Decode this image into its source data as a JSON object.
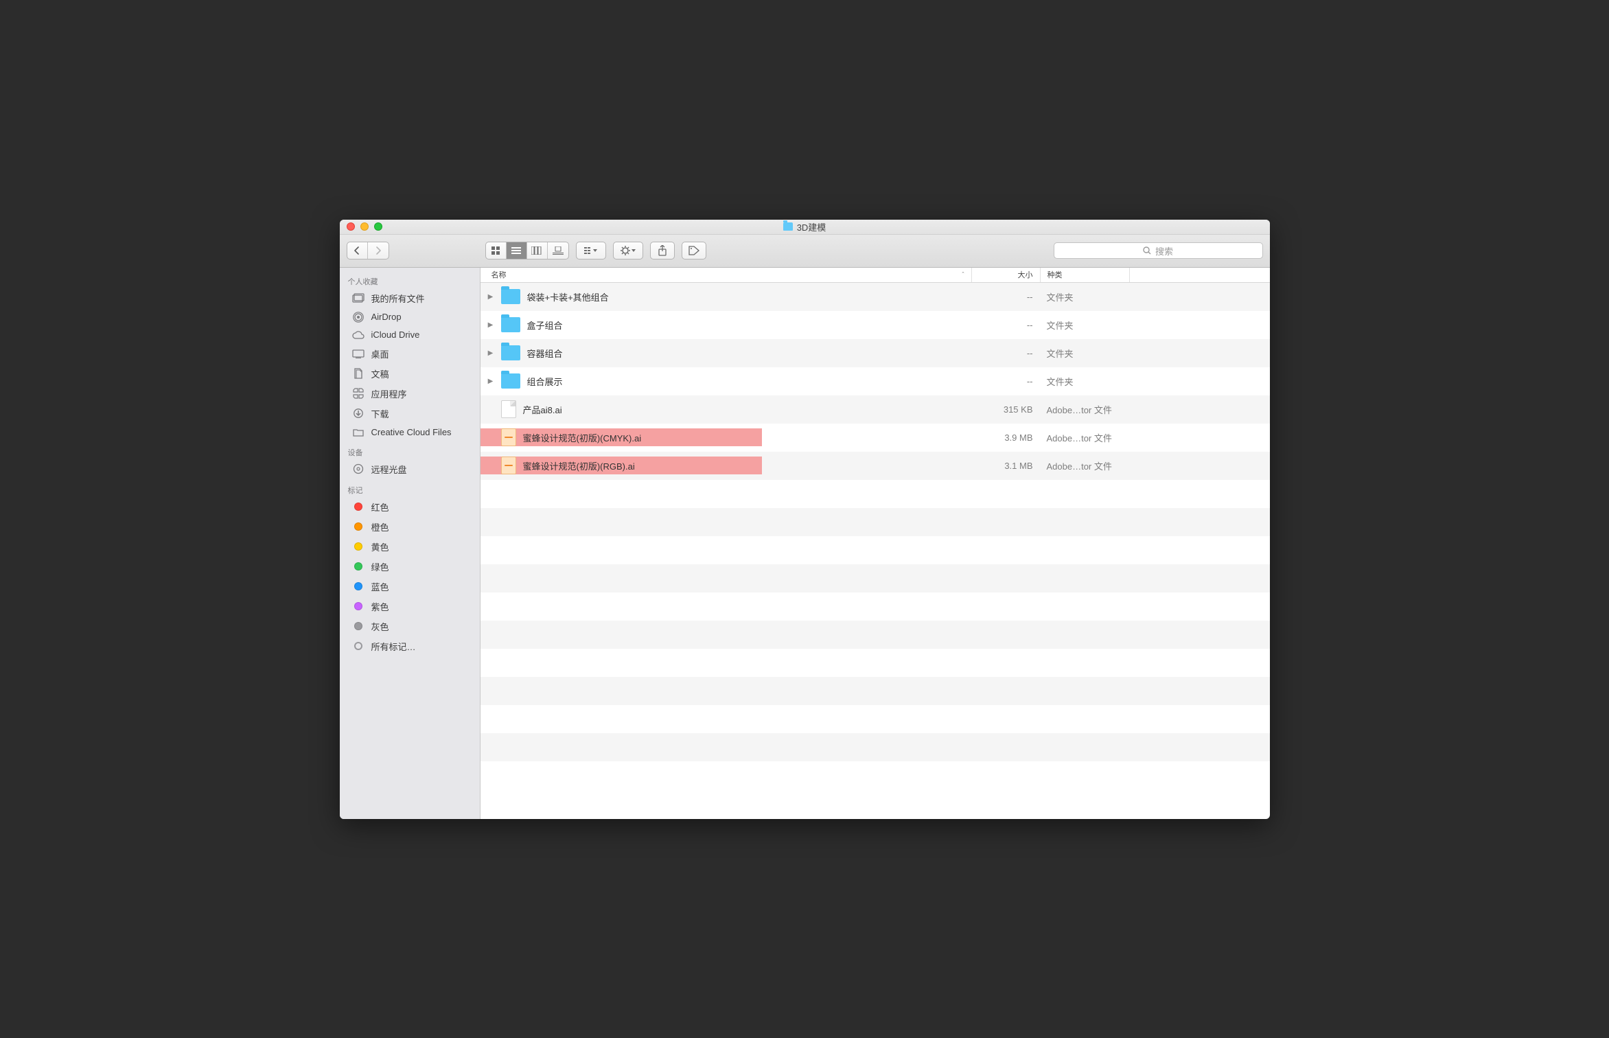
{
  "window": {
    "title": "3D建模"
  },
  "search": {
    "placeholder": "搜索"
  },
  "sidebar": {
    "favorites_header": "个人收藏",
    "favorites": [
      {
        "label": "我的所有文件",
        "icon": "all-files"
      },
      {
        "label": "AirDrop",
        "icon": "airdrop"
      },
      {
        "label": "iCloud Drive",
        "icon": "icloud"
      },
      {
        "label": "桌面",
        "icon": "desktop"
      },
      {
        "label": "文稿",
        "icon": "documents"
      },
      {
        "label": "应用程序",
        "icon": "applications"
      },
      {
        "label": "下载",
        "icon": "downloads"
      },
      {
        "label": "Creative Cloud Files",
        "icon": "folder"
      }
    ],
    "devices_header": "设备",
    "devices": [
      {
        "label": "远程光盘",
        "icon": "disc"
      }
    ],
    "tags_header": "标记",
    "tags": [
      {
        "label": "红色",
        "color": "red"
      },
      {
        "label": "橙色",
        "color": "orange"
      },
      {
        "label": "黄色",
        "color": "yellow"
      },
      {
        "label": "绿色",
        "color": "green"
      },
      {
        "label": "蓝色",
        "color": "blue"
      },
      {
        "label": "紫色",
        "color": "purple"
      },
      {
        "label": "灰色",
        "color": "gray"
      },
      {
        "label": "所有标记…",
        "color": "outline"
      }
    ]
  },
  "columns": {
    "name": "名称",
    "size": "大小",
    "kind": "种类",
    "sort_indicator": "ˆ"
  },
  "rows": [
    {
      "type": "folder",
      "name": "袋装+卡装+其他组合",
      "size": "--",
      "kind": "文件夹",
      "highlight": false
    },
    {
      "type": "folder",
      "name": "盒子组合",
      "size": "--",
      "kind": "文件夹",
      "highlight": false
    },
    {
      "type": "folder",
      "name": "容器组合",
      "size": "--",
      "kind": "文件夹",
      "highlight": false
    },
    {
      "type": "folder",
      "name": "组合展示",
      "size": "--",
      "kind": "文件夹",
      "highlight": false
    },
    {
      "type": "doc",
      "name": "产品ai8.ai",
      "size": "315 KB",
      "kind": "Adobe…tor 文件",
      "highlight": false
    },
    {
      "type": "ai",
      "name": "蜜蜂设计规范(初版)(CMYK).ai",
      "size": "3.9 MB",
      "kind": "Adobe…tor 文件",
      "highlight": true
    },
    {
      "type": "ai",
      "name": "蜜蜂设计规范(初版)(RGB).ai",
      "size": "3.1 MB",
      "kind": "Adobe…tor 文件",
      "highlight": true
    }
  ],
  "blank_rows": 11
}
